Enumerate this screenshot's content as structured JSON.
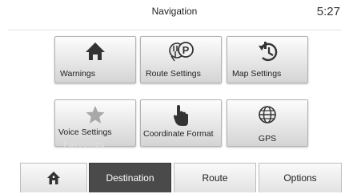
{
  "header": {
    "title": "Navigation",
    "clock": "5:27"
  },
  "tiles": [
    {
      "label": "Warnings",
      "icon": "home-icon"
    },
    {
      "label": "Route Settings",
      "icon": "route-settings-icon"
    },
    {
      "label": "Map Settings",
      "icon": "map-settings-icon"
    },
    {
      "label": "Voice Settings",
      "icon": "star-icon",
      "ghost": "Favourites"
    },
    {
      "label": "Coordinate Format",
      "icon": "hand-pointer-icon"
    },
    {
      "label": "GPS",
      "icon": "globe-icon"
    }
  ],
  "tabs": [
    {
      "label": "",
      "icon": "home-icon"
    },
    {
      "label": "Destination",
      "active": true
    },
    {
      "label": "Route"
    },
    {
      "label": "Options"
    }
  ],
  "colors": {
    "active_tab": "#4a4a4a",
    "tile_gradient_top": "#fdfdfd",
    "tile_gradient_bottom": "#d4d4d4"
  }
}
